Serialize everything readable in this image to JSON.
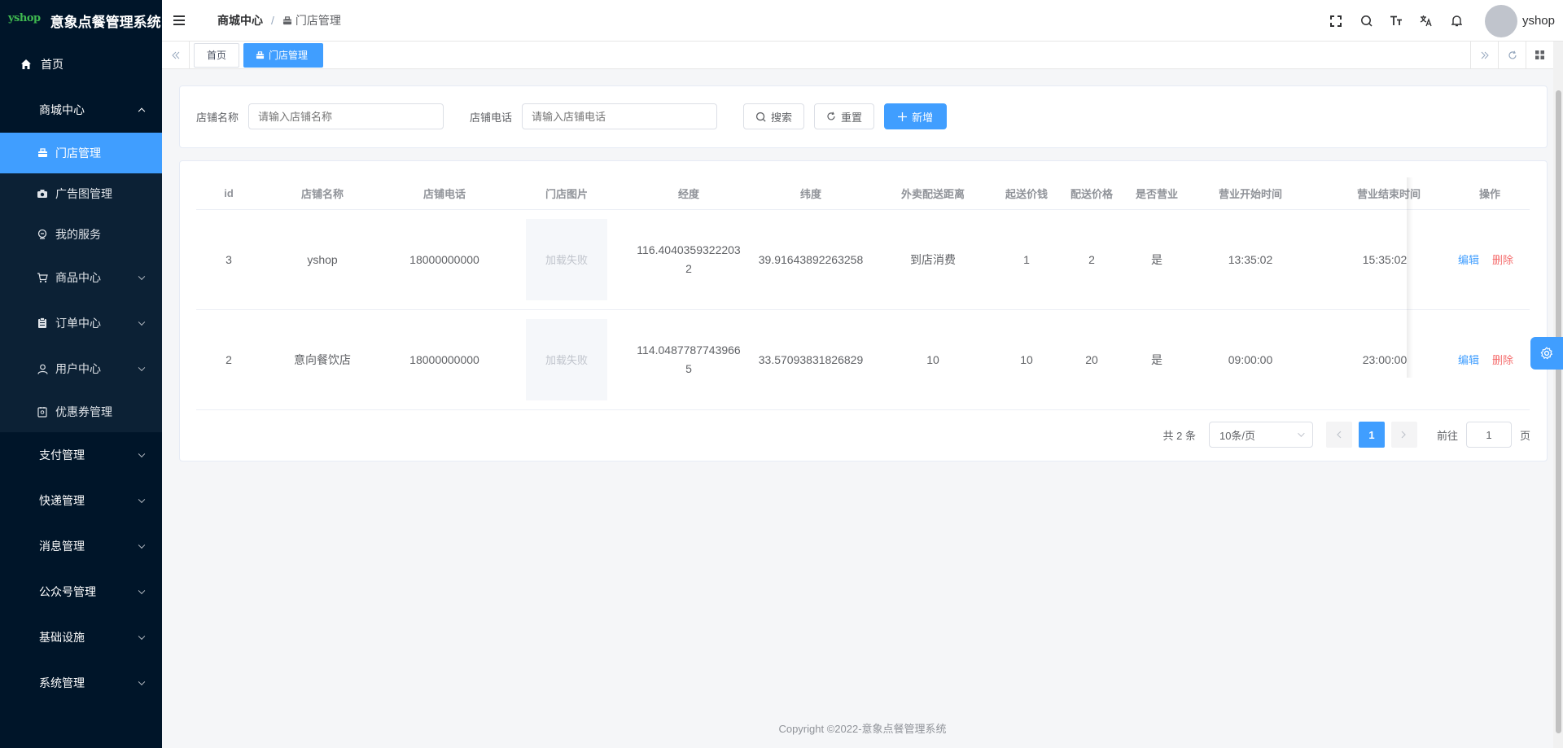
{
  "brand": {
    "logo_text": "yshop",
    "title": "意象点餐管理系统"
  },
  "sidebar": {
    "home": "首页",
    "mall_center": {
      "label": "商城中心",
      "children": [
        "门店管理",
        "广告图管理",
        "我的服务",
        "商品中心",
        "订单中心",
        "用户中心",
        "优惠券管理"
      ]
    },
    "groups": [
      "支付管理",
      "快递管理",
      "消息管理",
      "公众号管理",
      "基础设施",
      "系统管理"
    ]
  },
  "header": {
    "breadcrumb_parent": "商城中心",
    "breadcrumb_separator": "/",
    "breadcrumb_current": "门店管理",
    "username": "yshop"
  },
  "tags": {
    "home": "首页",
    "active": "门店管理"
  },
  "search": {
    "name_label": "店铺名称",
    "name_placeholder": "请输入店铺名称",
    "phone_label": "店铺电话",
    "phone_placeholder": "请输入店铺电话",
    "search_btn": "搜索",
    "reset_btn": "重置",
    "add_btn": "新增"
  },
  "table": {
    "columns": [
      "id",
      "店铺名称",
      "店铺电话",
      "门店图片",
      "经度",
      "纬度",
      "外卖配送距离",
      "起送价钱",
      "配送价格",
      "是否营业",
      "营业开始时间",
      "营业结束时间",
      "操作"
    ],
    "rows": [
      {
        "id": "3",
        "name": "yshop",
        "phone": "18000000000",
        "image": "加载失败",
        "lng": "116.40403593222032",
        "lat": "39.91643892263258",
        "distance": "到店消费",
        "min_price": "1",
        "delivery_price": "2",
        "open": "是",
        "start": "13:35:02",
        "end": "15:35:02",
        "edit": "编辑",
        "delete": "删除"
      },
      {
        "id": "2",
        "name": "意向餐饮店",
        "phone": "18000000000",
        "image": "加载失败",
        "lng": "114.04877877439665",
        "lat": "33.57093831826829",
        "distance": "10",
        "min_price": "10",
        "delivery_price": "20",
        "open": "是",
        "start": "09:00:00",
        "end": "23:00:00",
        "edit": "编辑",
        "delete": "删除"
      }
    ]
  },
  "pagination": {
    "total": "共 2 条",
    "page_size": "10条/页",
    "current": "1",
    "goto_label": "前往",
    "goto_value": "1",
    "page_unit": "页"
  },
  "footer": {
    "copyright": "Copyright ©2022-意象点餐管理系统"
  },
  "colors": {
    "sidebar_bg": "#001529",
    "accent": "#409eff",
    "danger": "#f56c6c"
  }
}
